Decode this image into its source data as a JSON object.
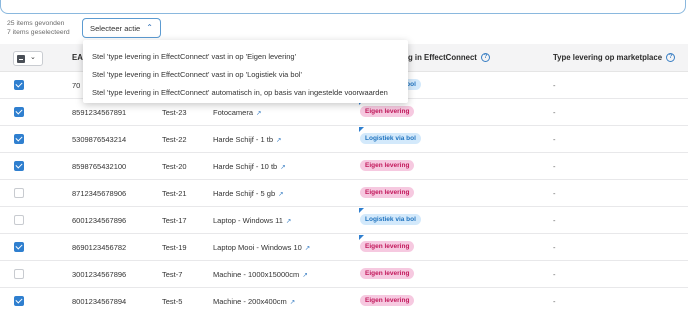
{
  "selection": {
    "found": "25 items gevonden",
    "selected": "7 items geselecteerd"
  },
  "action_button": {
    "label": "Selecteer actie"
  },
  "menu": {
    "items": [
      "Stel 'type levering in EffectConnect' vast in op 'Eigen levering'",
      "Stel 'type levering in EffectConnect' vast in op 'Logistiek via bol'",
      "Stel 'type levering in EffectConnect' automatisch in, op basis van ingestelde voorwaarden"
    ]
  },
  "table": {
    "columns": {
      "ean": "EA",
      "delivery_effectconnect": "g in EffectConnect",
      "delivery_marketplace": "Type levering op marketplace",
      "help_glyph": "?"
    },
    "rows": [
      {
        "checked": true,
        "ean": "70",
        "sku": "",
        "title": "",
        "badge": "Logistiek via bol",
        "badge_type": "bol",
        "marketplace": "-",
        "flag": false
      },
      {
        "checked": true,
        "ean": "8591234567891",
        "sku": "Test-23",
        "title": "Fotocamera",
        "badge": "Eigen levering",
        "badge_type": "eigen",
        "marketplace": "-",
        "flag": true
      },
      {
        "checked": true,
        "ean": "5309876543214",
        "sku": "Test-22",
        "title": "Harde Schijf - 1 tb",
        "badge": "Logistiek via bol",
        "badge_type": "bol",
        "marketplace": "-",
        "flag": true
      },
      {
        "checked": true,
        "ean": "8598765432100",
        "sku": "Test-20",
        "title": "Harde Schijf - 10 tb",
        "badge": "Eigen levering",
        "badge_type": "eigen",
        "marketplace": "-",
        "flag": false
      },
      {
        "checked": false,
        "ean": "8712345678906",
        "sku": "Test-21",
        "title": "Harde Schijf - 5 gb",
        "badge": "Eigen levering",
        "badge_type": "eigen",
        "marketplace": "-",
        "flag": false
      },
      {
        "checked": false,
        "ean": "6001234567896",
        "sku": "Test-17",
        "title": "Laptop - Windows 11",
        "badge": "Logistiek via bol",
        "badge_type": "bol",
        "marketplace": "-",
        "flag": true
      },
      {
        "checked": true,
        "ean": "8690123456782",
        "sku": "Test-19",
        "title": "Laptop Mooi - Windows 10",
        "badge": "Eigen levering",
        "badge_type": "eigen",
        "marketplace": "-",
        "flag": true
      },
      {
        "checked": false,
        "ean": "3001234567896",
        "sku": "Test-7",
        "title": "Machine - 1000x15000cm",
        "badge": "Eigen levering",
        "badge_type": "eigen",
        "marketplace": "-",
        "flag": false
      },
      {
        "checked": true,
        "ean": "8001234567894",
        "sku": "Test-5",
        "title": "Machine - 200x400cm",
        "badge": "Eigen levering",
        "badge_type": "eigen",
        "marketplace": "-",
        "flag": false
      }
    ]
  },
  "icons": {
    "external_link": "↗",
    "chevron_up": "⌃",
    "chevron_down": "⌄"
  }
}
